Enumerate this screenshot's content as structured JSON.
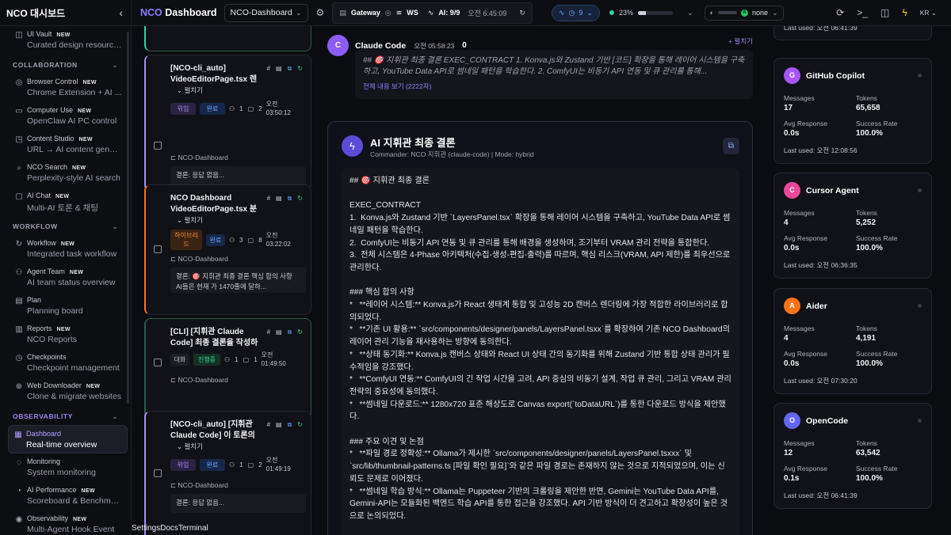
{
  "sidebar": {
    "brand": "NCO 대시보드",
    "items_top": [
      {
        "title": "UI Vault",
        "new": "NEW",
        "desc": "Curated design resources",
        "icon": "vault-icon",
        "glyph": "◫"
      }
    ],
    "sections": [
      {
        "label": "COLLABORATION",
        "items": [
          {
            "title": "Browser Control",
            "new": "NEW",
            "desc": "Chrome Extension + AI ...",
            "icon": "globe-icon",
            "glyph": "◎"
          },
          {
            "title": "Computer Use",
            "new": "NEW",
            "desc": "OpenClaw AI PC control",
            "icon": "monitor-icon",
            "glyph": "▭"
          },
          {
            "title": "Content Studio",
            "new": "NEW",
            "desc": "URL → AI content gener...",
            "icon": "studio-icon",
            "glyph": "◳"
          },
          {
            "title": "NCO Search",
            "new": "NEW",
            "desc": "Perplexity-style AI search",
            "icon": "search-icon",
            "glyph": "⌕"
          },
          {
            "title": "AI Chat",
            "new": "NEW",
            "desc": "Multi-AI 토론 & 채팅",
            "icon": "chat-icon",
            "glyph": "▢"
          }
        ]
      },
      {
        "label": "WORKFLOW",
        "items": [
          {
            "title": "Workflow",
            "new": "NEW",
            "desc": "Integrated task workflow",
            "icon": "workflow-icon",
            "glyph": "↻"
          },
          {
            "title": "Agent Team",
            "new": "NEW",
            "desc": "AI team status overview",
            "icon": "team-icon",
            "glyph": "⚇"
          },
          {
            "title": "Plan",
            "new": "",
            "desc": "Planning board",
            "icon": "plan-icon",
            "glyph": "▤"
          },
          {
            "title": "Reports",
            "new": "NEW",
            "desc": "NCO Reports",
            "icon": "report-icon",
            "glyph": "▥"
          },
          {
            "title": "Checkpoints",
            "new": "",
            "desc": "Checkpoint management",
            "icon": "checkpoint-icon",
            "glyph": "◷"
          },
          {
            "title": "Web Downloader",
            "new": "NEW",
            "desc": "Clone & migrate websites",
            "icon": "download-icon",
            "glyph": "⊕"
          }
        ]
      },
      {
        "label": "OBSERVABILITY",
        "items": [
          {
            "title": "Dashboard",
            "new": "",
            "desc": "Real-time overview",
            "icon": "dashboard-icon",
            "glyph": "▦",
            "active": true
          },
          {
            "title": "Monitoring",
            "new": "",
            "desc": "System monitoring",
            "icon": "monitoring-icon",
            "glyph": "◌"
          },
          {
            "title": "AI Performance",
            "new": "NEW",
            "desc": "Scoreboard & Benchmar...",
            "icon": "performance-icon",
            "glyph": "◔"
          },
          {
            "title": "Observability",
            "new": "NEW",
            "desc": "Multi-Agent Hook Event",
            "icon": "observability-icon",
            "glyph": "◉"
          }
        ]
      }
    ]
  },
  "topbar": {
    "title_prefix": "NCO",
    "title_suffix": " Dashboard",
    "project_select": "NCO-Dashboard",
    "gateway_label": "Gateway",
    "ws_label": "WS",
    "ai_label": "AI: 9/9",
    "clock": "오전 6:45:09",
    "activity_count": "9",
    "memory_percent": "23%",
    "memory_fraction": 0.23,
    "model_badge": "A",
    "model_name": "none",
    "language": "KR"
  },
  "sessions": [
    {
      "title": "[NCO-cli_auto] VideoEditorPage.tsx 렌더링 성능 최적화 분석. 현재: useEffe...",
      "expand": "펼치기",
      "tags": [
        "위임",
        "완료"
      ],
      "agents": "1",
      "messages": "2",
      "time": "오전 03:50:12",
      "project": "NCO-Dashboard",
      "result": "결론: 응답 없음..."
    },
    {
      "title": "NCO Dashboard VideoEditorPage.tsx 분석 및 최적화...",
      "expand": "펼치기",
      "tags": [
        "하이브리드",
        "완료"
      ],
      "agents": "3",
      "messages": "8",
      "time": "오전 03:22:02",
      "project": "NCO-Dashboard",
      "result": "결론: 🎯 지휘관 최종 결론 핵심 합의 사항 AI들은 현재 가 1470줄에 달하..."
    },
    {
      "title": "[CLI] [지휘관 Claude Code] 최종 결론을 작성하세요.",
      "expand": "",
      "tags": [
        "대화",
        "진행중"
      ],
      "agents": "1",
      "messages": "1",
      "time": "오전 01:49:50",
      "project": "NCO-Dashboard",
      "result": ""
    },
    {
      "title": "[NCO-cli_auto] [지휘관 Claude Code] 이 토론의 최종 결론을 작성하...",
      "expand": "펼치기",
      "tags": [
        "위임",
        "완료"
      ],
      "agents": "1",
      "messages": "2",
      "time": "오전 01:49:19",
      "project": "NCO-Dashboard",
      "result": "결론: 응답 없음..."
    }
  ],
  "message": {
    "avatar": "C",
    "author": "Claude Code",
    "time": "오전 05:58:23",
    "count": "0",
    "expand_label": "+ 펼치기",
    "quote": "## 🎯 지휘관 최종 결론 EXEC_CONTRACT 1. Konva.js와 Zustand 기반 [코드] 확장을 통해 레이어 시스템을 구축하고, YouTube Data API로 썸네일 패턴을 학습한다. 2. ComfyUI는 비동기 API 연동 및 큐 관리를 통해...",
    "show_full": "전체 내용 보기 (2222자)"
  },
  "verdict": {
    "title": "AI 지휘관 최종 결론",
    "subtitle": "Commander: NCO 지휘관 (claude-code) | Mode: hybrid",
    "body": "## 🎯 지휘관 최종 결론\n\nEXEC_CONTRACT\n1.  Konva.js와 Zustand 기반 `LayersPanel.tsx` 확장을 통해 레이어 시스템을 구축하고, YouTube Data API로 썸네일 패턴을 학습한다.\n2.  ComfyUI는 비동기 API 연동 및 큐 관리를 통해 배경을 생성하며, 조기부터 VRAM 관리 전략을 통합한다.\n3.  전체 시스템은 4-Phase 아키텍처(수집-생성-편집-출력)를 따르며, 핵심 리스크(VRAM, API 제한)를 최우선으로 관리한다.\n\n### 핵심 합의 사항\n*   **레이어 시스템:** Konva.js가 React 생태계 통합 및 고성능 2D 캔버스 렌더링에 가장 적합한 라이브러리로 합의되었다.\n*   **기존 UI 활용:** `src/components/designer/panels/LayersPanel.tsxx`를 확장하여 기존 NCO Dashboard의 레이어 관리 기능을 재사용하는 방향에 동의한다.\n*   **상태 동기화:** Konva.js 캔버스 상태와 React UI 상태 간의 동기화를 위해 Zustand 기반 통합 상태 관리가 필수적임을 강조했다.\n*   **ComfyUI 연동:** ComfyUI의 긴 작업 시간을 고려, API 중심의 비동기 설계, 작업 큐 관리, 그리고 VRAM 관리 전략의 중요성에 동의했다.\n*   **썸네일 다운로드:** 1280x720 표준 해상도로 Canvas export(`toDataURL`)를 통한 다운로드 방식을 제안했다.\n\n### 주요 이견 및 논점\n*   **파일 경로 정확성:** Ollama가 제시한 `src/components/designer/panels/LayersPanel.tsxxx` 및 `src/lib/thumbnail-patterns.ts [파일 확인 필요]`와 같은 파일 경로는 존재하지 않는 것으로 지적되었으며, 이는 신뢰도 문제로 이어졌다.\n*   **썸네일 학습 방식:** Ollama는 Puppeteer 기반의 크롤링을 제안한 반면, Gemini는 YouTube Data API를, Gemini-API는 모듈화된 백엔드 학습 API를 통한 접근을 강조했다. API 기반 방식이 더 견고하고 확장성이 높은 것으로 논의되었다."
  },
  "bottom_links": [
    "Settings",
    "Docs",
    "Terminal"
  ],
  "agents_stats": {
    "partial_last_used": "Last used: 오전 06:41:39",
    "labels": {
      "messages": "Messages",
      "tokens": "Tokens",
      "avg": "Avg Response",
      "success": "Success Rate"
    },
    "cards": [
      {
        "avatar": "G",
        "color": "#a855f7",
        "name": "GitHub Copilot",
        "messages": "17",
        "tokens": "65,658",
        "avg": "0.0s",
        "success": "100.0%",
        "last": "Last used: 오전 12:08:56"
      },
      {
        "avatar": "C",
        "color": "#ec4899",
        "name": "Cursor Agent",
        "messages": "4",
        "tokens": "5,252",
        "avg": "0.0s",
        "success": "100.0%",
        "last": "Last used: 오전 06:36:35"
      },
      {
        "avatar": "A",
        "color": "#f97316",
        "name": "Aider",
        "messages": "4",
        "tokens": "4,191",
        "avg": "0.0s",
        "success": "100.0%",
        "last": "Last used: 오전 07:30:20"
      },
      {
        "avatar": "O",
        "color": "#6366f1",
        "name": "OpenCode",
        "messages": "12",
        "tokens": "63,542",
        "avg": "0.1s",
        "success": "100.0%",
        "last": "Last used: 오전 06:41:39"
      }
    ]
  }
}
